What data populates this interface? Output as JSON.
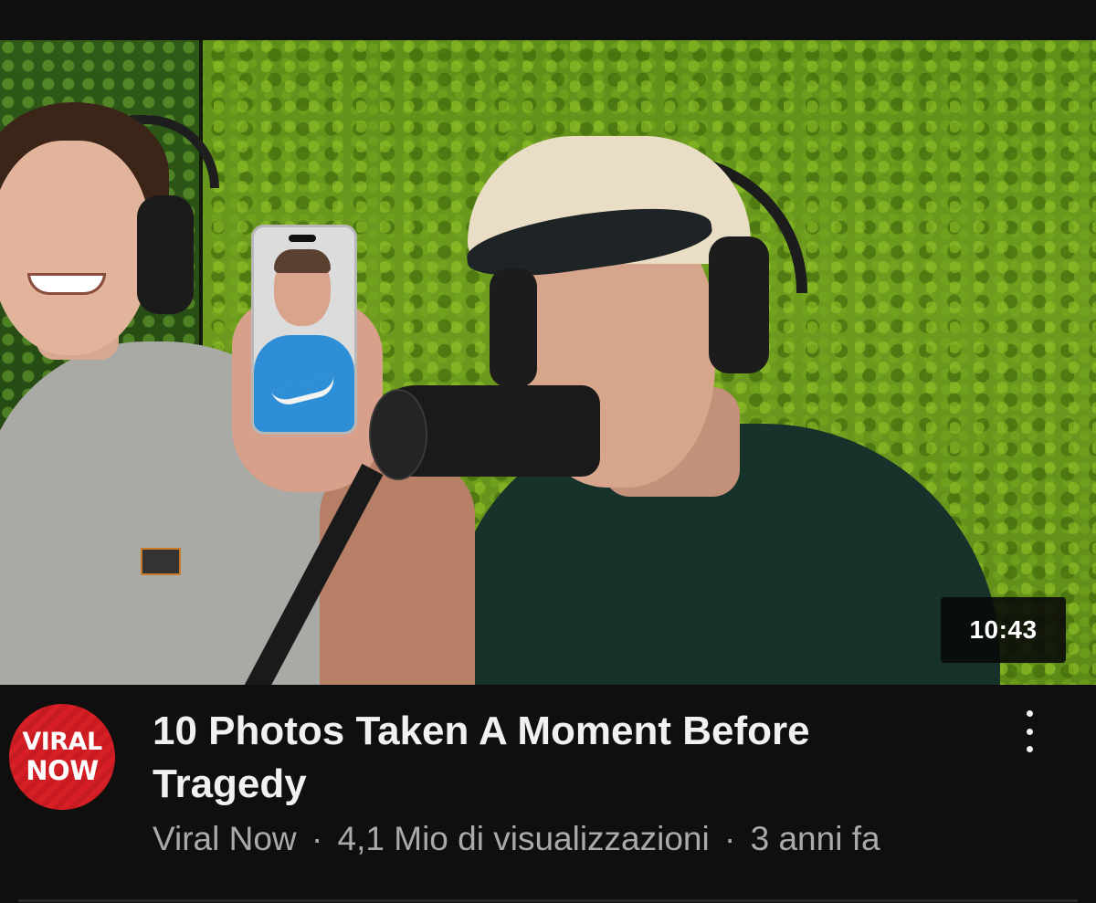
{
  "video": {
    "duration": "10:43",
    "title": "10 Photos Taken A Moment Before Tragedy",
    "channel": "Viral Now",
    "views": "4,1 Mio di visualizzazioni",
    "age": "3 anni fa",
    "separator": "·"
  },
  "channel_avatar": {
    "line1": "VIRAL",
    "line2": "NOW",
    "color": "#d71f26"
  },
  "icons": {
    "more": "more-vertical-icon"
  }
}
